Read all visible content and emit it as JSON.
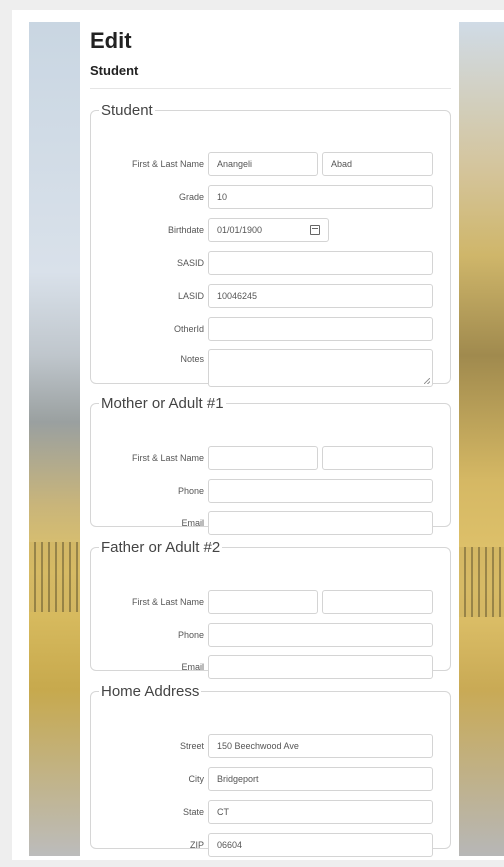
{
  "header": {
    "title": "Edit",
    "subtitle": "Student"
  },
  "student": {
    "legend": "Student",
    "name_label": "First & Last Name",
    "first_name": "Anangeli",
    "last_name": "Abad",
    "grade_label": "Grade",
    "grade": "10",
    "birthdate_label": "Birthdate",
    "birthdate": "01/01/1900",
    "sasid_label": "SASID",
    "sasid": "",
    "lasid_label": "LASID",
    "lasid": "10046245",
    "otherid_label": "OtherId",
    "otherid": "",
    "notes_label": "Notes",
    "notes": ""
  },
  "mother": {
    "legend": "Mother or Adult #1",
    "name_label": "First & Last Name",
    "first_name": "",
    "last_name": "",
    "phone_label": "Phone",
    "phone": "",
    "email_label": "Email",
    "email": ""
  },
  "father": {
    "legend": "Father or Adult #2",
    "name_label": "First & Last Name",
    "first_name": "",
    "last_name": "",
    "phone_label": "Phone",
    "phone": "",
    "email_label": "Email",
    "email": ""
  },
  "address": {
    "legend": "Home Address",
    "street_label": "Street",
    "street": "150 Beechwood Ave",
    "city_label": "City",
    "city": "Bridgeport",
    "state_label": "State",
    "state": "CT",
    "zip_label": "ZIP",
    "zip": "06604"
  },
  "icons": {
    "calendar": "calendar-icon",
    "resize": "resize-grip-icon"
  }
}
